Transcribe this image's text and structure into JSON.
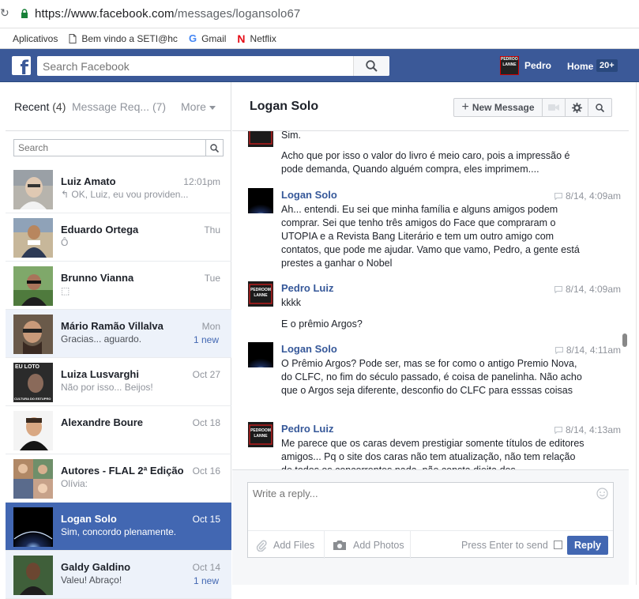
{
  "browser": {
    "url_host": "https://www.facebook.com",
    "url_path": "/messages/logansolo67",
    "bookmarks": [
      {
        "label": "Aplicativos",
        "icon": "apps-grid-icon"
      },
      {
        "label": "Bem vindo a SETI@hc",
        "icon": "page-icon"
      },
      {
        "label": "Gmail",
        "icon": "google-icon"
      },
      {
        "label": "Netflix",
        "icon": "netflix-icon"
      }
    ]
  },
  "fb": {
    "logo": "f",
    "search_placeholder": "Search Facebook",
    "user_name": "Pedro",
    "user_avatar_text": "PEDROOM LANNE",
    "home_label": "Home",
    "home_badge": "20+"
  },
  "left": {
    "tab_recent": "Recent",
    "tab_recent_count": "(4)",
    "tab_requests": "Message Req... (7)",
    "tab_more": "More",
    "search_placeholder": "Search",
    "conversations": [
      {
        "name": "Luiz Amato",
        "snippet": "↰ OK, Luiz, eu vou providen...",
        "time": "12:01pm",
        "new": "",
        "state": "normal"
      },
      {
        "name": "Eduardo Ortega",
        "snippet": "Ô",
        "time": "Thu",
        "new": "",
        "state": "normal"
      },
      {
        "name": "Brunno Vianna",
        "snippet": "⬚",
        "time": "Tue",
        "new": "",
        "state": "normal"
      },
      {
        "name": "Mário Ramão Villalva",
        "snippet": "Gracias... aguardo.",
        "time": "Mon",
        "new": "1 new",
        "state": "unread"
      },
      {
        "name": "Luiza Lusvarghi",
        "snippet": "Não por isso... Beijos!",
        "time": "Oct 27",
        "new": "",
        "state": "normal"
      },
      {
        "name": "Alexandre Boure",
        "snippet": "",
        "time": "Oct 18",
        "new": "",
        "state": "normal"
      },
      {
        "name": "Autores - FLAL 2ª Edição",
        "snippet": "Olívia:",
        "time": "Oct 16",
        "new": "",
        "state": "normal"
      },
      {
        "name": "Logan Solo",
        "snippet": "Sim, concordo plenamente.",
        "time": "Oct 15",
        "new": "",
        "state": "selected"
      },
      {
        "name": "Galdy Galdino",
        "snippet": "Valeu! Abraço!",
        "time": "Oct 14",
        "new": "1 new",
        "state": "unread"
      }
    ],
    "avatar_texts": {
      "luiza": "EU LOTO",
      "luiza_bottom": "CULTURA DO ESTUPRO"
    }
  },
  "thread": {
    "title": "Logan Solo",
    "new_message_label": "New Message",
    "groups": [
      {
        "sender": "",
        "avatar": "pedro",
        "time": "",
        "lines": [
          "Sim.",
          "Acho que por isso o valor do livro é meio caro, pois a impressão é pode demanda, Quando alguém compra, eles imprimem...."
        ]
      },
      {
        "sender": "Logan Solo",
        "avatar": "logan",
        "time": "8/14, 4:09am",
        "lines": [
          "Ah... entendi. Eu sei que minha família e alguns amigos podem comprar. Sei que tenho três amigos do Face que compraram o UTOPIA e a Revista Bang Literário e tem um outro amigo com contatos, que pode me ajudar. Vamo que vamo, Pedro, a gente está prestes a ganhar o Nobel"
        ]
      },
      {
        "sender": "Pedro Luiz",
        "avatar": "pedro",
        "time": "8/14, 4:09am",
        "lines": [
          "kkkk",
          "E o prêmio Argos?"
        ]
      },
      {
        "sender": "Logan Solo",
        "avatar": "logan",
        "time": "8/14, 4:11am",
        "lines": [
          "O Prêmio Argos? Pode ser, mas se for como o antigo Premio Nova, do CLFC, no fim do século passado, é coisa de panelinha. Não acho que o Argos seja diferente, desconfio do CLFC para esssas coisas"
        ]
      },
      {
        "sender": "Pedro Luiz",
        "avatar": "pedro",
        "time": "8/14, 4:13am",
        "lines": [
          "Me parece que os caras devem prestigiar somente títulos de editores amigos... Pq o site dos caras não tem atualização, não tem relação de todos os concorrentes nada, não consta dieita dos"
        ]
      }
    ],
    "pedro_avatar_text": "PEDROOM LANNE"
  },
  "composer": {
    "placeholder": "Write a reply...",
    "add_files": "Add Files",
    "add_photos": "Add Photos",
    "press_enter": "Press Enter to send",
    "reply": "Reply"
  },
  "colors": {
    "fb_blue": "#3b5998",
    "selected": "#4267b2",
    "unread_bg": "#edf2fa",
    "link": "#365899"
  }
}
